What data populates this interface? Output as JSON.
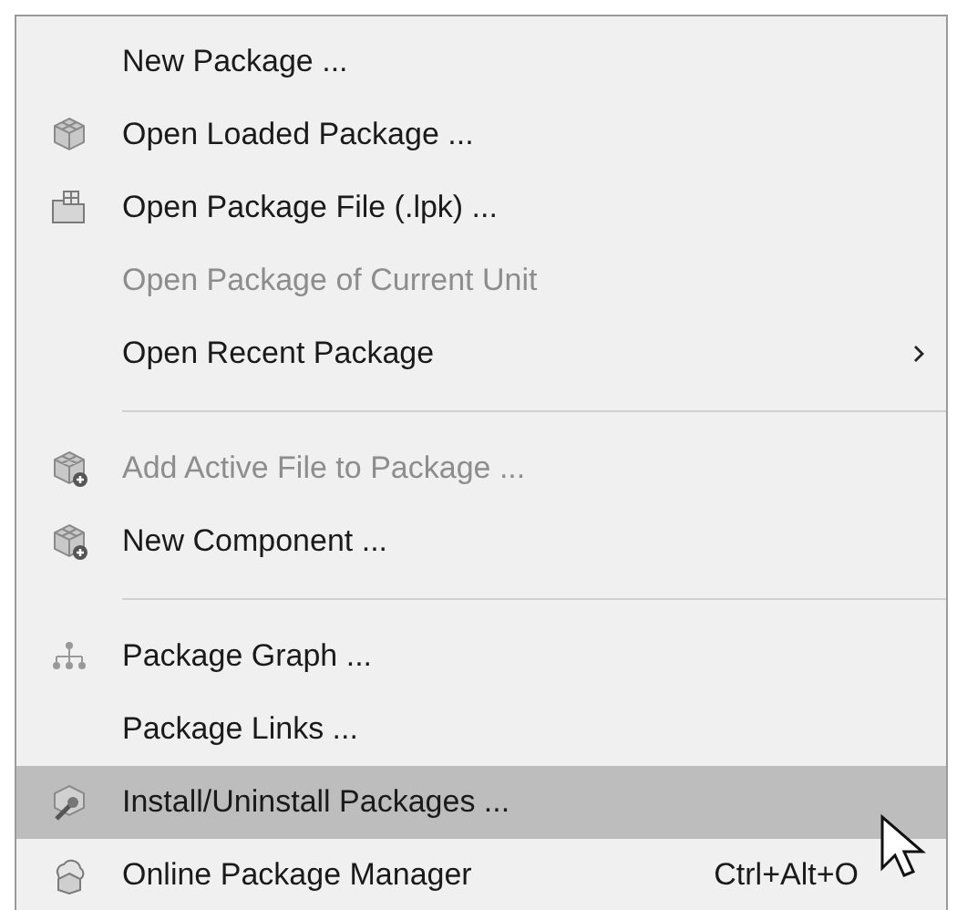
{
  "menu": {
    "items": [
      {
        "kind": "item",
        "label": "New Package ...",
        "disabled": false,
        "selected": false
      },
      {
        "kind": "item",
        "label": "Open Loaded Package ...",
        "disabled": false,
        "selected": false
      },
      {
        "kind": "item",
        "label": "Open Package File (.lpk) ...",
        "disabled": false,
        "selected": false
      },
      {
        "kind": "item",
        "label": "Open Package of Current Unit",
        "disabled": true,
        "selected": false
      },
      {
        "kind": "item",
        "label": "Open Recent Package",
        "disabled": false,
        "selected": false,
        "submenu": true
      },
      {
        "kind": "separator"
      },
      {
        "kind": "item",
        "label": "Add Active File to Package ...",
        "disabled": true,
        "selected": false
      },
      {
        "kind": "item",
        "label": "New Component ...",
        "disabled": false,
        "selected": false
      },
      {
        "kind": "separator"
      },
      {
        "kind": "item",
        "label": "Package Graph ...",
        "disabled": false,
        "selected": false
      },
      {
        "kind": "item",
        "label": "Package Links ...",
        "disabled": false,
        "selected": false
      },
      {
        "kind": "item",
        "label": "Install/Uninstall Packages ...",
        "disabled": false,
        "selected": true
      },
      {
        "kind": "item",
        "label": "Online Package Manager",
        "disabled": false,
        "selected": false,
        "shortcut": "Ctrl+Alt+O"
      }
    ]
  }
}
